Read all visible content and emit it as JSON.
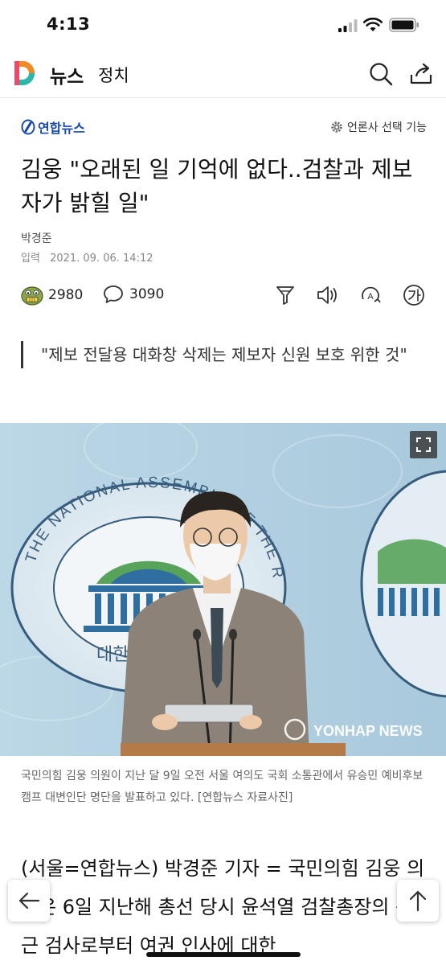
{
  "status_bar": {
    "time": "4:13"
  },
  "header": {
    "app_name": "뉴스",
    "section": "정치"
  },
  "press": {
    "name": "연합뉴스",
    "select_label": "언론사 선택 기능"
  },
  "article": {
    "headline": "김웅 \"오래된 일 기억에 없다..검찰과 제보자가 밝힐 일\"",
    "reporter": "박경준",
    "date_label": "입력",
    "date": "2021. 09. 06. 14:12",
    "reaction_count": "2980",
    "comment_count": "3090",
    "summary": "\"제보 전달용 대화창 삭제는 제보자 신원 보호 위한 것\"",
    "photo_caption": "국민의힘 김웅 의원이 지난 달 9일 오전 서울 여의도 국회 소통관에서 유승민 예비후보 캠프 대변인단 명단을 발표하고 있다. [연합뉴스 자료사진]",
    "body": "(서울=연합뉴스) 박경준 기자 = 국민의힘 김웅 의원은 6일 지난해 총선 당시 윤석열 검찰총장의 측근 검사로부터 여권 인사에 대한",
    "photo_text": {
      "assembly_seal": "THE NATIONAL ASSEMBLY OF THE REPUBLIC OF KOREA",
      "seal_korean": "대한민국 국회",
      "watermark": "YONHAP NEWS"
    }
  },
  "colors": {
    "press_blue": "#1a4aa8",
    "logo_orange": "#f08a24",
    "logo_purple": "#7a4dd8"
  }
}
